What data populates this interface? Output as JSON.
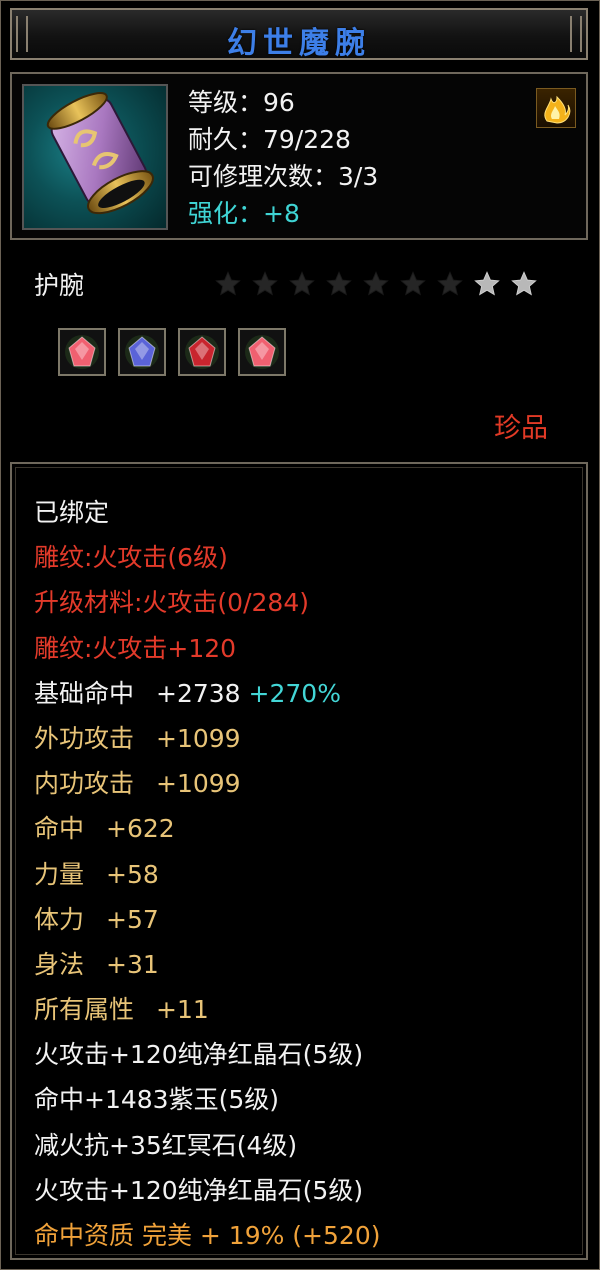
{
  "item": {
    "name": "幻世魔腕",
    "level_text": "等级：96",
    "durability_text": "耐久：79/228",
    "repair_text": "可修理次数：3/3",
    "refine_text": "强化：+8",
    "type": "护腕",
    "quality": "珍品",
    "stars_total": 9,
    "stars_filled": 2,
    "gems": [
      {
        "name": "纯净红晶石",
        "icon": "pink-gem-icon",
        "color": "#f06070"
      },
      {
        "name": "紫玉",
        "icon": "blue-gem-icon",
        "color": "#5a63d8"
      },
      {
        "name": "红冥石",
        "icon": "red-gem-icon",
        "color": "#c8252e"
      },
      {
        "name": "纯净红晶石",
        "icon": "pink-gem-icon",
        "color": "#f06070"
      }
    ]
  },
  "attributes": {
    "bound": "已绑定",
    "engrave": "雕纹:火攻击(6级)",
    "upgrade_material": "升级材料:火攻击(0/284)",
    "engrave_bonus": "雕纹:火攻击+120",
    "base_hit_label": "基础命中",
    "base_hit_value": "+2738",
    "base_hit_pct": "+270%",
    "outer_atk_label": "外功攻击",
    "outer_atk_value": "+1099",
    "inner_atk_label": "内功攻击",
    "inner_atk_value": "+1099",
    "hit_label": "命中",
    "hit_value": "+622",
    "str_label": "力量",
    "str_value": "+58",
    "vit_label": "体力",
    "vit_value": "+57",
    "agi_label": "身法",
    "agi_value": "+31",
    "all_label": "所有属性",
    "all_value": "+11",
    "gem1": "火攻击+120纯净红晶石(5级)",
    "gem2": "命中+1483紫玉(5级)",
    "gem3": "减火抗+35红冥石(4级)",
    "gem4": "火攻击+120纯净红晶石(5级)",
    "aptitude": "命中资质 完美 + 19% (+520)"
  },
  "colors": {
    "title": "#3d7fe8",
    "red": "#e33a2a",
    "gold": "#e8c478",
    "cyan": "#43d6d6",
    "orange": "#f0a23a",
    "frame": "#6f685c"
  }
}
